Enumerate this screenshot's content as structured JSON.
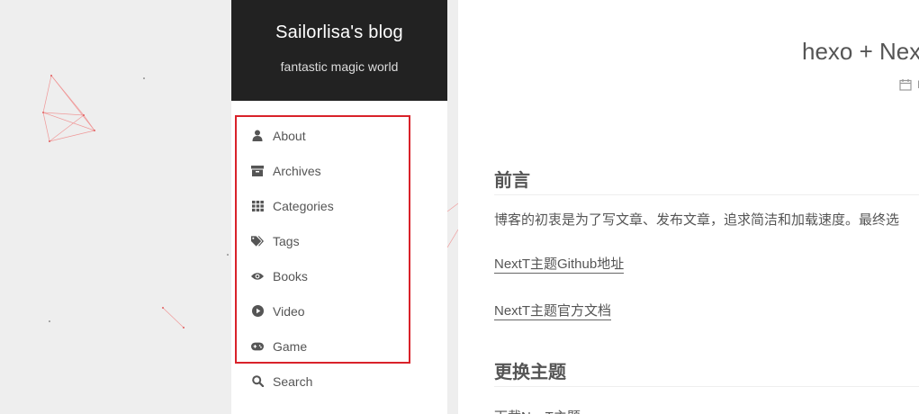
{
  "site": {
    "title": "Sailorlisa's blog",
    "subtitle": "fantastic magic world"
  },
  "menu": [
    {
      "label": "About",
      "icon": "user-icon"
    },
    {
      "label": "Archives",
      "icon": "archive-icon"
    },
    {
      "label": "Categories",
      "icon": "th-grid-icon"
    },
    {
      "label": "Tags",
      "icon": "tags-icon"
    },
    {
      "label": "Books",
      "icon": "eye-icon"
    },
    {
      "label": "Video",
      "icon": "play-circle-icon"
    },
    {
      "label": "Game",
      "icon": "gamepad-icon"
    },
    {
      "label": "Search",
      "icon": "search-icon"
    }
  ],
  "post": {
    "title": "hexo + Nex",
    "meta_text": "Р",
    "section1_heading": "前言",
    "para1": "博客的初衷是为了写文章、发布文章，追求简洁和加载速度。最终选",
    "link1": "NextT主题Github地址",
    "link2": "NextT主题官方文档",
    "section2_heading": "更换主题",
    "para2": "下载NexT主题"
  },
  "colors": {
    "header_bg": "#222222",
    "highlight": "#d9222a",
    "background": "#eeeeee"
  }
}
